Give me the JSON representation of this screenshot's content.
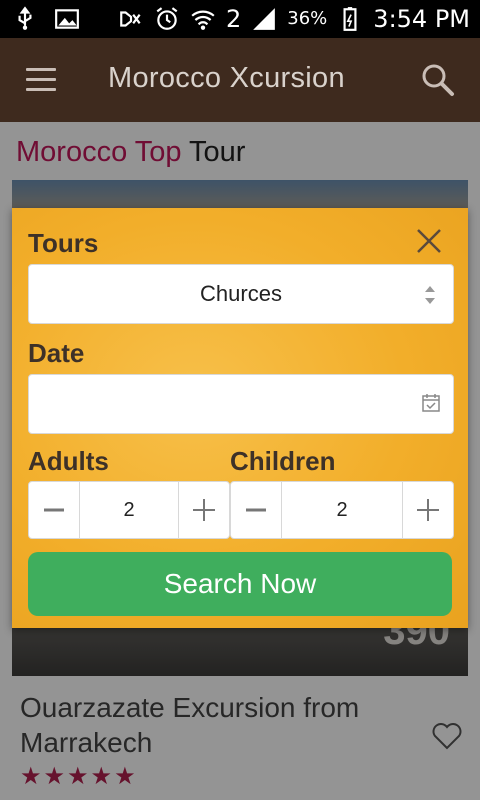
{
  "status_bar": {
    "time": "3:54 PM",
    "battery": "36%",
    "sim_slot": "2",
    "icons": [
      "usb-icon",
      "image-icon",
      "mute-icon",
      "alarm-icon",
      "wifi-icon",
      "signal-icon",
      "battery-icon"
    ]
  },
  "app_bar": {
    "title": "Morocco Xcursion",
    "menu_icon": "hamburger-icon",
    "search_icon": "search-icon",
    "background": "#3e2a1e"
  },
  "section": {
    "title_highlight": "Morocco Top",
    "title_rest": "Tour",
    "highlight_color": "#c2185b"
  },
  "card": {
    "price": "390",
    "title": "Ouarzazate Excursion from Marrakech",
    "rating_stars": 5,
    "stars_text": "★★★★★",
    "favorite_icon": "heart-outline-icon"
  },
  "dialog": {
    "tours_label": "Tours",
    "tours_selected": "Churces",
    "date_label": "Date",
    "date_value": "",
    "adults_label": "Adults",
    "adults_value": "2",
    "children_label": "Children",
    "children_value": "2",
    "submit_label": "Search Now",
    "submit_color": "#3fae5d",
    "accent_color": "#f2ae2a"
  }
}
